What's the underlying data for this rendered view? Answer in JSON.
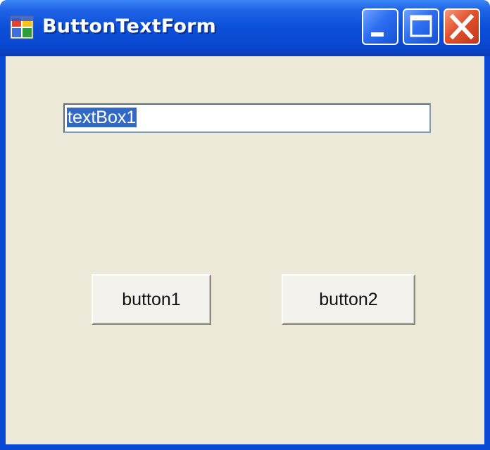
{
  "window": {
    "title": "ButtonTextForm",
    "icon": "windows-form-icon",
    "controls": {
      "minimize": "minimize-icon",
      "maximize": "maximize-icon",
      "close": "close-icon"
    }
  },
  "form": {
    "textbox": {
      "value": "textBox1",
      "selected": true
    },
    "button1": {
      "label": "button1"
    },
    "button2": {
      "label": "button2"
    }
  },
  "colors": {
    "titlebar": "#0a47d0",
    "client_background": "#ece9d8",
    "selection": "#316ac5",
    "close_button": "#e2522d"
  }
}
